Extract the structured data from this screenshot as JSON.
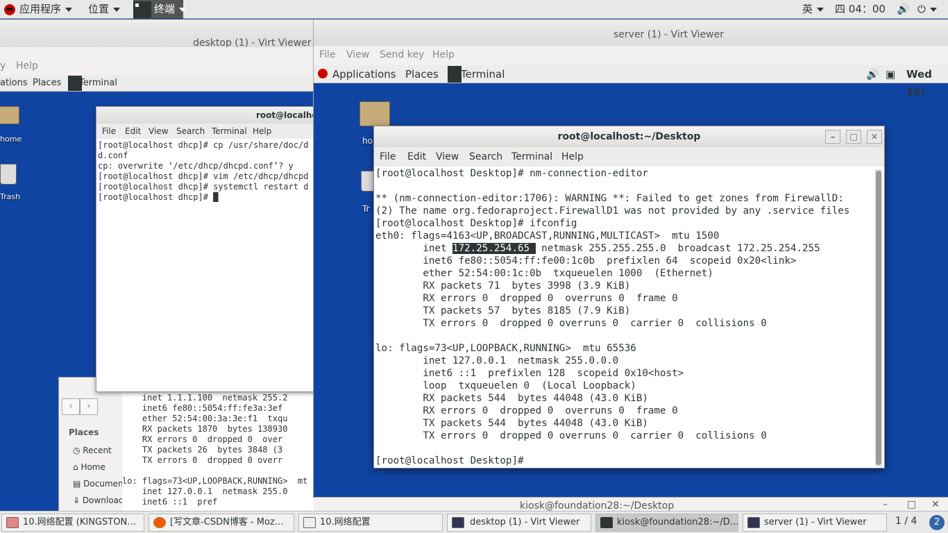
{
  "host_bar": {
    "applications_label": "应用程序",
    "places_label": "位置",
    "terminal_label": "终端",
    "input_method": "英",
    "clock": "四 04：00"
  },
  "desktop_viewer": {
    "title": "desktop (1) - Virt Viewer",
    "menu": [
      "y",
      "Help"
    ],
    "guest_bar": {
      "apps": "ations",
      "places": "Places",
      "terminal": "Terminal"
    },
    "icons": {
      "home": "home",
      "trash": "Trash"
    },
    "terminal": {
      "title": "root@localhos",
      "menu": [
        "File",
        "Edit",
        "View",
        "Search",
        "Terminal",
        "Help"
      ],
      "lines": [
        "[root@localhost dhcp]# cp /usr/share/doc/d",
        "d.conf",
        "cp: overwrite ‘/etc/dhcp/dhcpd.conf’? y",
        "[root@localhost dhcp]# vim /etc/dhcp/dhcpd",
        "[root@localhost dhcp]# systemctl restart d",
        "[root@localhost dhcp]# "
      ]
    },
    "file_manager": {
      "sidebar_heading": "Places",
      "items": [
        "Recent",
        "Home",
        "Document",
        "Downloads"
      ]
    },
    "bg_terminal_lines": [
      "    inet 1.1.1.100  netmask 255.2",
      "    inet6 fe80::5054:ff:fe3a:3ef",
      "    ether 52:54:00:3a:3e:f1  txqu",
      "    RX packets 1870  bytes 138930",
      "    RX errors 0  dropped 0  over",
      "    TX packets 26  bytes 3848 (3",
      "    TX errors 0  dropped 0 overr",
      "",
      "lo: flags=73<UP,LOOPBACK,RUNNING>  mt",
      "    inet 127.0.0.1  netmask 255.0",
      "    inet6 ::1  pref"
    ]
  },
  "server_viewer": {
    "title": "server (1) - Virt Viewer",
    "menu": [
      "File",
      "View",
      "Send key",
      "Help"
    ],
    "guest_bar": {
      "apps": "Applications",
      "places": "Places",
      "terminal": "Terminal",
      "clock": "Wed 16:"
    },
    "icons": {
      "home": "ho",
      "trash": "Tr"
    },
    "terminal": {
      "title": "root@localhost:~/Desktop",
      "menu": [
        "File",
        "Edit",
        "View",
        "Search",
        "Terminal",
        "Help"
      ],
      "lines_before": [
        "[root@localhost Desktop]# nm-connection-editor",
        "",
        "** (nm-connection-editor:1706): WARNING **: Failed to get zones from FirewallD:",
        "(2) The name org.fedoraproject.FirewallD1 was not provided by any .service files",
        "[root@localhost Desktop]# ifconfig",
        "eth0: flags=4163<UP,BROADCAST,RUNNING,MULTICAST>  mtu 1500"
      ],
      "inet_prefix": "        inet ",
      "inet_highlight": "172.25.254.65 ",
      "inet_suffix": " netmask 255.255.255.0  broadcast 172.25.254.255",
      "lines_after": [
        "        inet6 fe80::5054:ff:fe00:1c0b  prefixlen 64  scopeid 0x20<link>",
        "        ether 52:54:00:1c:0b  txqueuelen 1000  (Ethernet)",
        "        RX packets 71  bytes 3998 (3.9 KiB)",
        "        RX errors 0  dropped 0  overruns 0  frame 0",
        "        TX packets 57  bytes 8185 (7.9 KiB)",
        "        TX errors 0  dropped 0 overruns 0  carrier 0  collisions 0",
        "",
        "lo: flags=73<UP,LOOPBACK,RUNNING>  mtu 65536",
        "        inet 127.0.0.1  netmask 255.0.0.0",
        "        inet6 ::1  prefixlen 128  scopeid 0x10<host>",
        "        loop  txqueuelen 0  (Local Loopback)",
        "        RX packets 544  bytes 44048 (43.0 KiB)",
        "        RX errors 0  dropped 0  overruns 0  frame 0",
        "        TX packets 544  bytes 44048 (43.0 KiB)",
        "        TX errors 0  dropped 0 overruns 0  carrier 0  collisions 0",
        "",
        "[root@localhost Desktop]#"
      ]
    }
  },
  "kiosk_window": {
    "title": "kiosk@foundation28:~/Desktop"
  },
  "taskbar": {
    "items": [
      "10.网络配置 (KINGSTON…",
      "[写文章-CSDN博客 - Moz…",
      "10.网络配置",
      "desktop (1) - Virt Viewer",
      "kiosk@foundation28:~/D…",
      "server (1) - Virt Viewer"
    ],
    "workspace": "1 / 4",
    "notifications": "2"
  },
  "colors": {
    "desktop_blue": "#1044a3",
    "panel_gray": "#e8e8e7",
    "redhat_red": "#cc0000"
  }
}
